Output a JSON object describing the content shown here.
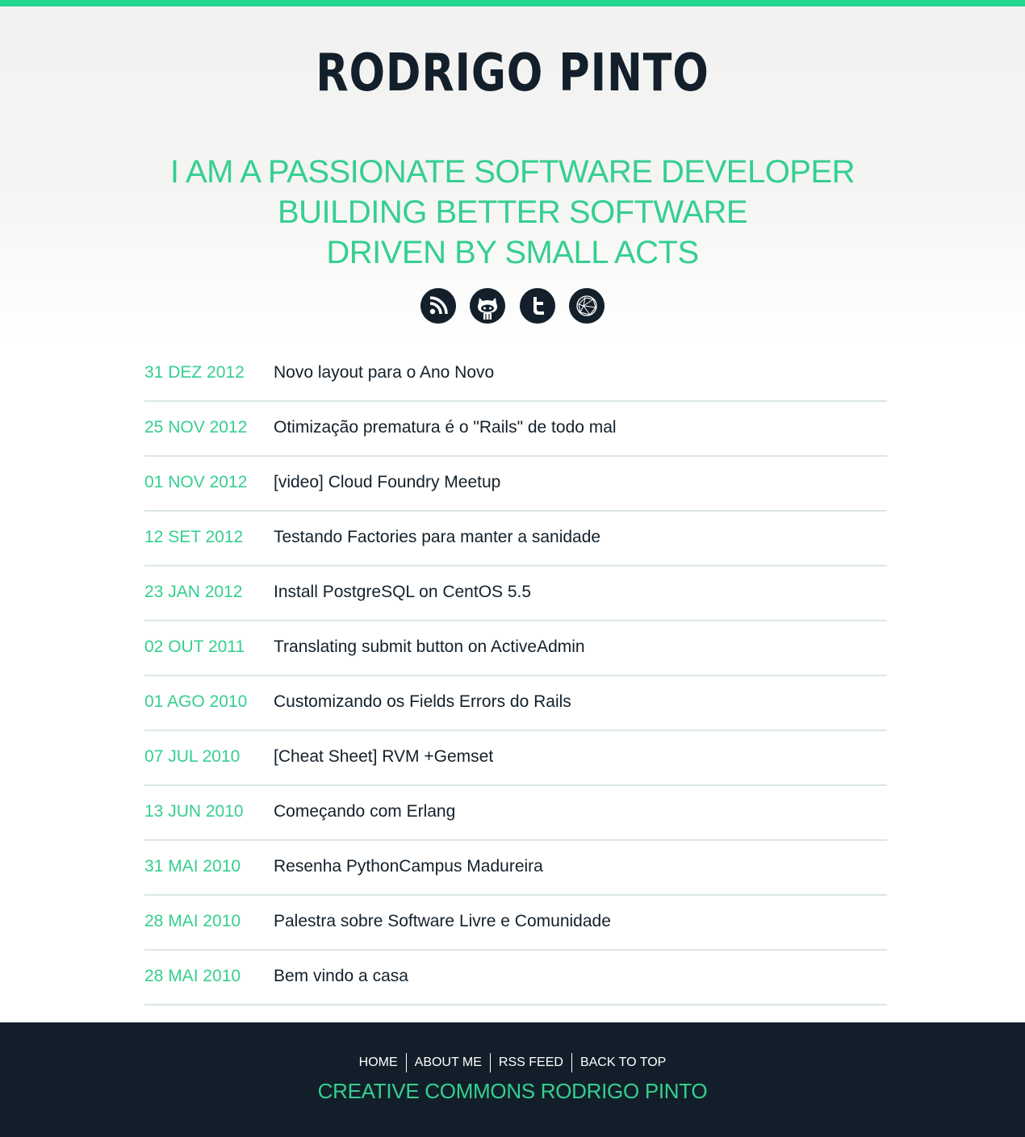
{
  "colors": {
    "accent": "#24d68e",
    "accent_text": "#35cf8f",
    "dark": "#13202b",
    "divider": "#dbe6e3",
    "footer_bg": "#121f2a"
  },
  "header": {
    "title": "RODRIGO PINTO",
    "tagline": [
      "I AM A PASSIONATE SOFTWARE DEVELOPER",
      "BUILDING BETTER SOFTWARE",
      "DRIVEN BY SMALL ACTS"
    ]
  },
  "social": {
    "items": [
      {
        "icon": "rss-icon"
      },
      {
        "icon": "github-icon"
      },
      {
        "icon": "twitter-icon"
      },
      {
        "icon": "workingwithrails-icon"
      }
    ]
  },
  "posts": [
    {
      "date": "31 DEZ 2012",
      "title": "Novo layout para o Ano Novo"
    },
    {
      "date": "25 NOV 2012",
      "title": "Otimização prematura é o \"Rails\" de todo mal"
    },
    {
      "date": "01 NOV 2012",
      "title": "[video] Cloud Foundry Meetup"
    },
    {
      "date": "12 SET 2012",
      "title": "Testando Factories para manter a sanidade"
    },
    {
      "date": "23 JAN 2012",
      "title": "Install PostgreSQL on CentOS 5.5"
    },
    {
      "date": "02 OUT 2011",
      "title": "Translating submit button on ActiveAdmin"
    },
    {
      "date": "01 AGO 2010",
      "title": "Customizando os Fields Errors do Rails"
    },
    {
      "date": "07 JUL 2010",
      "title": "[Cheat Sheet] RVM +Gemset"
    },
    {
      "date": "13 JUN 2010",
      "title": "Começando com Erlang"
    },
    {
      "date": "31 MAI 2010",
      "title": "Resenha PythonCampus Madureira"
    },
    {
      "date": "28 MAI 2010",
      "title": "Palestra sobre Software Livre e Comunidade"
    },
    {
      "date": "28 MAI 2010",
      "title": "Bem vindo a casa"
    }
  ],
  "footer": {
    "nav": {
      "home": "HOME",
      "about": "ABOUT ME",
      "rss": "RSS FEED",
      "top": "BACK TO TOP"
    },
    "credit": "CREATIVE COMMONS RODRIGO PINTO"
  }
}
